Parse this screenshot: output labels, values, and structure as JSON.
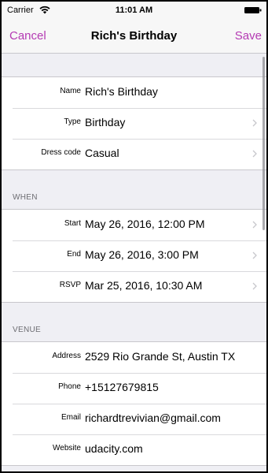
{
  "status": {
    "carrier": "Carrier",
    "time": "11:01 AM"
  },
  "nav": {
    "cancel_label": "Cancel",
    "title": "Rich's Birthday",
    "save_label": "Save"
  },
  "colors": {
    "accent": "#b43ab3",
    "background": "#efeff4",
    "separator": "#c8c7cc"
  },
  "details": [
    {
      "label": "Name",
      "value": "Rich's Birthday",
      "disclosure": false
    },
    {
      "label": "Type",
      "value": "Birthday",
      "disclosure": true
    },
    {
      "label": "Dress code",
      "value": "Casual",
      "disclosure": true
    }
  ],
  "when": {
    "header": "WHEN",
    "rows": [
      {
        "label": "Start",
        "value": "May 26, 2016, 12:00 PM",
        "disclosure": true
      },
      {
        "label": "End",
        "value": "May 26, 2016, 3:00 PM",
        "disclosure": true
      },
      {
        "label": "RSVP",
        "value": "Mar 25, 2016, 10:30 AM",
        "disclosure": true
      }
    ]
  },
  "venue": {
    "header": "VENUE",
    "rows": [
      {
        "label": "Address",
        "value": "2529 Rio Grande St, Austin TX",
        "disclosure": false
      },
      {
        "label": "Phone",
        "value": "+15127679815",
        "disclosure": false
      },
      {
        "label": "Email",
        "value": "richardtrevivian@gmail.com",
        "disclosure": false
      },
      {
        "label": "Website",
        "value": "udacity.com",
        "disclosure": false
      }
    ]
  }
}
